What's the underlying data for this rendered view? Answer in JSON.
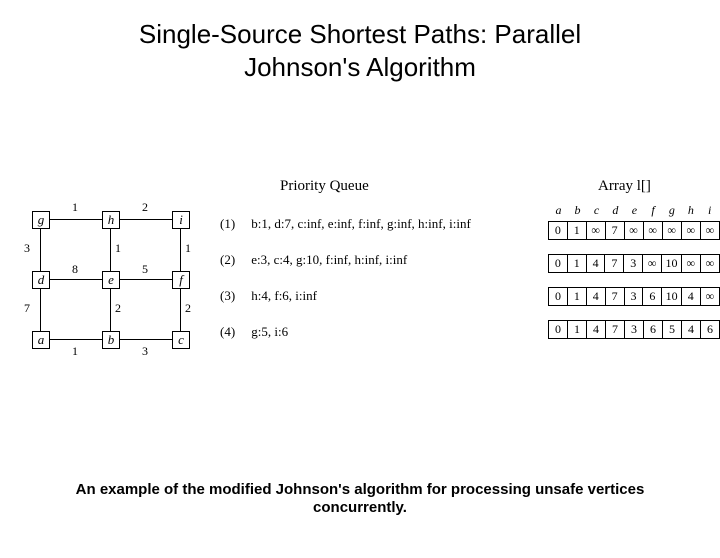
{
  "title_line1": "Single-Source Shortest Paths: Parallel",
  "title_line2": "Johnson's Algorithm",
  "headings": {
    "pq": "Priority Queue",
    "arr": "Array l[]"
  },
  "graph": {
    "nodes": [
      "g",
      "h",
      "i",
      "d",
      "e",
      "f",
      "a",
      "b",
      "c"
    ],
    "weights": {
      "gh": "1",
      "hi": "2",
      "gd": "3",
      "he": "1",
      "if": "1",
      "de": "8",
      "ef": "5",
      "da": "7",
      "eb": "2",
      "fc": "2",
      "ab": "1",
      "bc": "3"
    }
  },
  "pq": [
    {
      "n": "(1)",
      "text": "b:1, d:7, c:inf, e:inf, f:inf, g:inf, h:inf, i:inf"
    },
    {
      "n": "(2)",
      "text": "e:3, c:4, g:10, f:inf, h:inf, i:inf"
    },
    {
      "n": "(3)",
      "text": "h:4, f:6, i:inf"
    },
    {
      "n": "(4)",
      "text": "g:5, i:6"
    }
  ],
  "arr_header": [
    "a",
    "b",
    "c",
    "d",
    "e",
    "f",
    "g",
    "h",
    "i"
  ],
  "arrays": [
    [
      "0",
      "1",
      "∞",
      "7",
      "∞",
      "∞",
      "∞",
      "∞",
      "∞"
    ],
    [
      "0",
      "1",
      "4",
      "7",
      "3",
      "∞",
      "10",
      "∞",
      "∞"
    ],
    [
      "0",
      "1",
      "4",
      "7",
      "3",
      "6",
      "10",
      "4",
      "∞"
    ],
    [
      "0",
      "1",
      "4",
      "7",
      "3",
      "6",
      "5",
      "4",
      "6"
    ]
  ],
  "caption_line1": "An example of the modified Johnson's algorithm for processing unsafe vertices",
  "caption_line2": "concurrently."
}
